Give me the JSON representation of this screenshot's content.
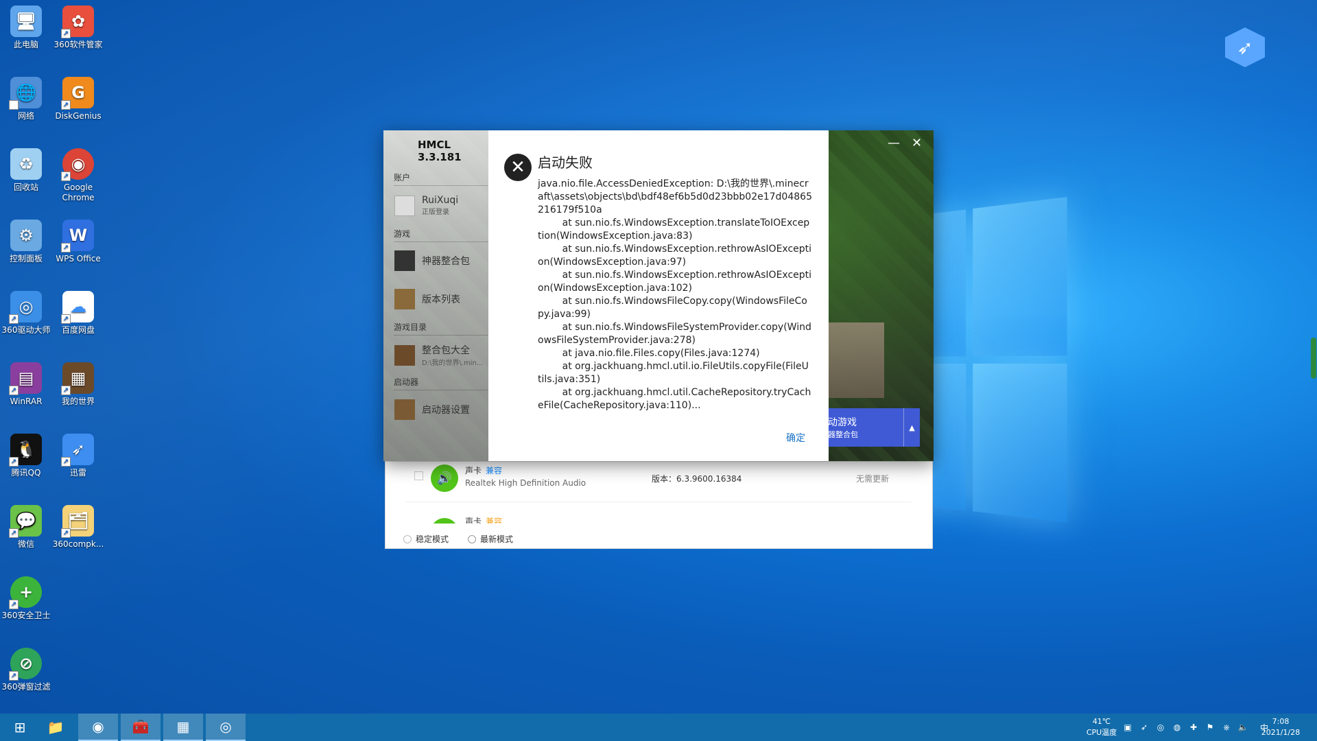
{
  "desktop": {
    "icons_col1": [
      {
        "label": "此电脑",
        "icon": "computer-icon",
        "color": "#5ea5ec"
      },
      {
        "label": "网络",
        "icon": "network-icon",
        "color": "#4f8fd8"
      },
      {
        "label": "回收站",
        "icon": "recycle-bin-icon",
        "color": "#9fd0f2"
      },
      {
        "label": "控制面板",
        "icon": "control-panel-icon",
        "color": "#6aa9e2"
      },
      {
        "label": "360驱动大师",
        "icon": "driver-master-icon",
        "color": "#3b8fe6"
      },
      {
        "label": "WinRAR",
        "icon": "winrar-icon",
        "color": "#8a3f9e"
      },
      {
        "label": "腾讯QQ",
        "icon": "qq-icon",
        "color": "#111111"
      },
      {
        "label": "微信",
        "icon": "wechat-icon",
        "color": "#6ac248"
      },
      {
        "label": "360安全卫士",
        "icon": "security-guard-icon",
        "color": "#3cb43c"
      },
      {
        "label": "360弹窗过滤",
        "icon": "popup-filter-icon",
        "color": "#2ea35a"
      }
    ],
    "icons_col2": [
      {
        "label": "360软件管家",
        "icon": "software-manager-icon",
        "color": "#e84f3d"
      },
      {
        "label": "DiskGenius",
        "icon": "diskgenius-icon",
        "color": "#f08a1c"
      },
      {
        "label": "Google Chrome",
        "icon": "chrome-icon",
        "color": "#db4437"
      },
      {
        "label": "WPS Office",
        "icon": "wps-icon",
        "color": "#2f6fe0"
      },
      {
        "label": "百度网盘",
        "icon": "baidu-netdisk-icon",
        "color": "#3b8ff6"
      },
      {
        "label": "我的世界",
        "icon": "minecraft-icon",
        "color": "#6b4a2a"
      },
      {
        "label": "迅雷",
        "icon": "thunder-icon",
        "color": "#3d8ef0"
      },
      {
        "label": "360compk...",
        "icon": "folder-zip-icon",
        "color": "#f3d27a"
      }
    ]
  },
  "driver_panel": {
    "row1": {
      "name": "声卡",
      "compat": "兼容",
      "desc": "Realtek High Definition Audio",
      "version": "版本：6.3.9600.16384",
      "update": "无需更新"
    },
    "row2": {
      "name": "声卡",
      "compat": "兼容"
    },
    "mode_stable": "稳定模式",
    "mode_latest": "最新模式"
  },
  "hmcl": {
    "title": "HMCL 3.3.181",
    "section_account": "账户",
    "account_name": "RuiXuqi",
    "account_sub": "正版登录",
    "section_game": "游戏",
    "item_modpack": "神器整合包",
    "item_versions": "版本列表",
    "section_gamedir": "游戏目录",
    "item_modpack_all": "整合包大全",
    "item_modpack_path": "D:\\我的世界\\.min...",
    "section_launcher": "启动器",
    "item_settings": "启动器设置",
    "launch_label": "动游戏",
    "launch_sub": "器整合包",
    "minimize": "—",
    "close": "✕"
  },
  "dialog": {
    "title": "启动失败",
    "body": "java.nio.file.AccessDeniedException: D:\\我的世界\\.minecraft\\assets\\objects\\bd\\bdf48ef6b5d0d23bbb02e17d04865216179f510a\n        at sun.nio.fs.WindowsException.translateToIOException(WindowsException.java:83)\n        at sun.nio.fs.WindowsException.rethrowAsIOException(WindowsException.java:97)\n        at sun.nio.fs.WindowsException.rethrowAsIOException(WindowsException.java:102)\n        at sun.nio.fs.WindowsFileCopy.copy(WindowsFileCopy.java:99)\n        at sun.nio.fs.WindowsFileSystemProvider.copy(WindowsFileSystemProvider.java:278)\n        at java.nio.file.Files.copy(Files.java:1274)\n        at org.jackhuang.hmcl.util.io.FileUtils.copyFile(FileUtils.java:351)\n        at org.jackhuang.hmcl.util.CacheRepository.tryCacheFile(CacheRepository.java:110)...",
    "ok": "确定"
  },
  "taskbar": {
    "start_icon": "windows-start-icon",
    "apps": [
      "file-explorer-icon",
      "chrome-icon",
      "toolbox-icon",
      "minecraft-icon",
      "driver-master-icon"
    ],
    "cpu_temp": "41℃",
    "cpu_label": "CPU温度",
    "ime": "中",
    "time": "7:08",
    "date": "2021/1/28"
  }
}
